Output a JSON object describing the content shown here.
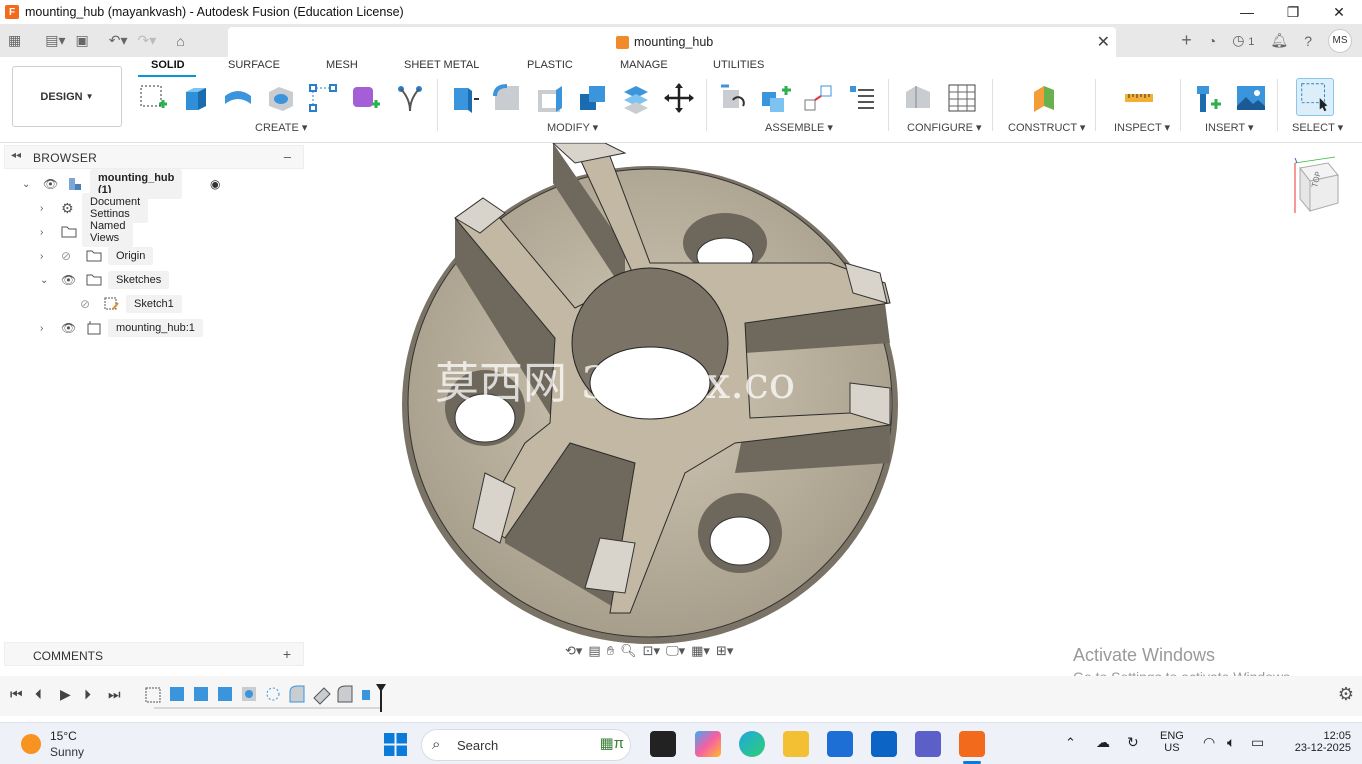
{
  "window": {
    "title": "mounting_hub (mayankvash) - Autodesk Fusion (Education License)",
    "minimize": "—",
    "maximize": "❐",
    "close": "✕"
  },
  "tabbar": {
    "doc_title": "mounting_hub",
    "close": "✕",
    "jobs_count": "1",
    "avatar": "MS"
  },
  "ribbon": {
    "workspace": "DESIGN",
    "tabs": [
      "SOLID",
      "SURFACE",
      "MESH",
      "SHEET METAL",
      "PLASTIC",
      "MANAGE",
      "UTILITIES"
    ],
    "groups": {
      "create": "CREATE",
      "modify": "MODIFY",
      "assemble": "ASSEMBLE",
      "configure": "CONFIGURE",
      "construct": "CONSTRUCT",
      "inspect": "INSPECT",
      "insert": "INSERT",
      "select": "SELECT"
    }
  },
  "browser": {
    "title": "BROWSER",
    "items": [
      {
        "label": "mounting_hub (1)"
      },
      {
        "label": "Document Settings"
      },
      {
        "label": "Named Views"
      },
      {
        "label": "Origin"
      },
      {
        "label": "Sketches"
      },
      {
        "label": "Sketch1"
      },
      {
        "label": "mounting_hub:1"
      }
    ]
  },
  "comments": {
    "title": "COMMENTS",
    "add": "+"
  },
  "viewcube": {
    "face": "TOP"
  },
  "watermark": "莫西网 3dmox.co",
  "activate": {
    "line1": "Activate Windows",
    "line2": "Go to Settings to activate Windows."
  },
  "taskbar": {
    "temp": "15°C",
    "weather": "Sunny",
    "search_placeholder": "Search",
    "lang1": "ENG",
    "lang2": "US",
    "time": "12:05",
    "date": "23-12-2025"
  },
  "colors": {
    "accent": "#0696d7",
    "part_base": "#b5ab99",
    "part_shadow": "#6f685d"
  }
}
